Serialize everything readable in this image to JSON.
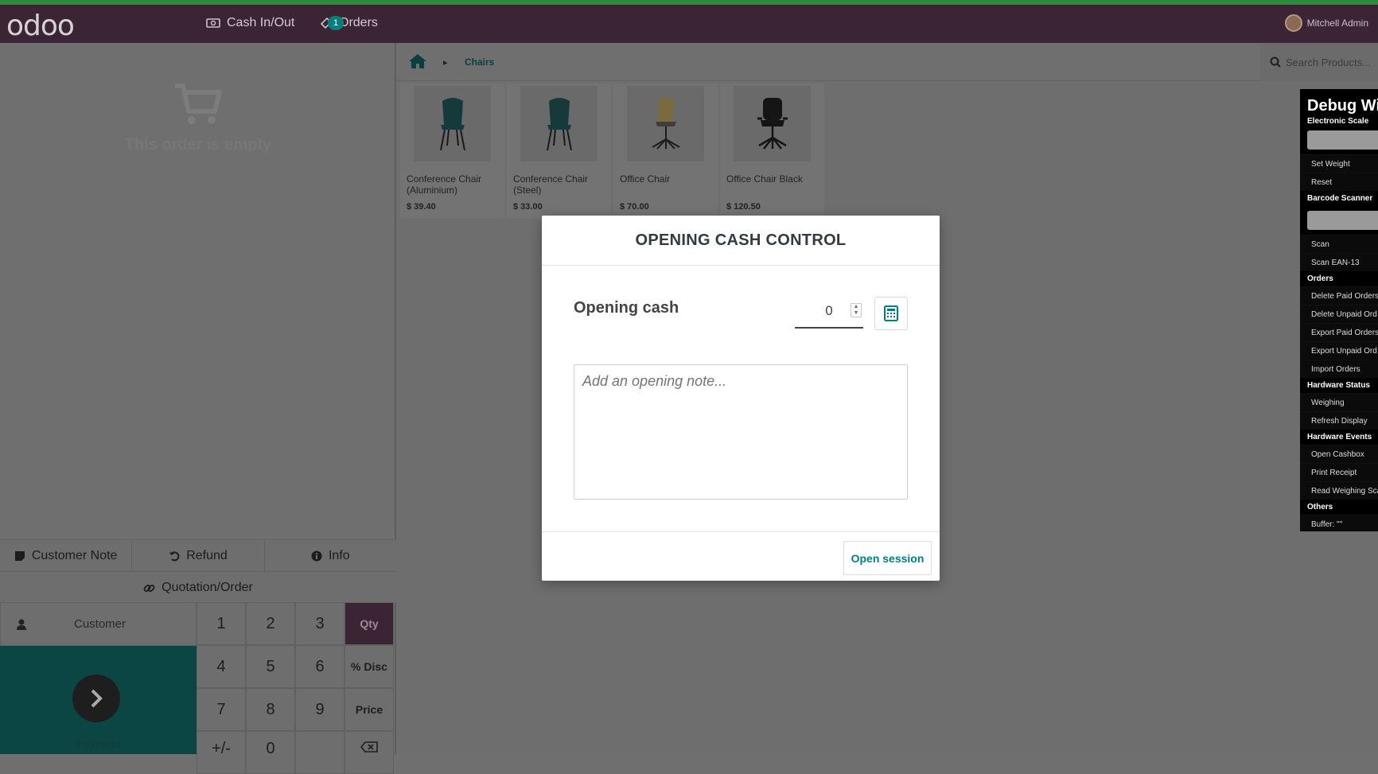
{
  "navbar": {
    "logo": "odoo",
    "cash_in_out": "Cash In/Out",
    "orders": "Orders",
    "orders_count": "1",
    "user_name": "Mitchell Admin"
  },
  "order": {
    "empty_text": "This order is empty"
  },
  "controls": {
    "customer_note": "Customer Note",
    "refund": "Refund",
    "info": "Info",
    "quotation_order": "Quotation/Order"
  },
  "numpad": {
    "customer": "Customer",
    "payment": "Payment",
    "keys": [
      "1",
      "2",
      "3",
      "4",
      "5",
      "6",
      "7",
      "8",
      "9",
      "+/-",
      "0"
    ],
    "modes": {
      "qty": "Qty",
      "disc": "% Disc",
      "price": "Price"
    }
  },
  "breadcrumb": {
    "category": "Chairs"
  },
  "search": {
    "placeholder": "Search Products..."
  },
  "products": [
    {
      "name": "Conference Chair (Aluminium)",
      "price": "$ 39.40"
    },
    {
      "name": "Conference Chair (Steel)",
      "price": "$ 33.00"
    },
    {
      "name": "Office Chair",
      "price": "$ 70.00"
    },
    {
      "name": "Office Chair Black",
      "price": "$ 120.50"
    }
  ],
  "debug": {
    "title": "Debug Wi",
    "electronic_scale": "Electronic Scale",
    "set_weight": "Set Weight",
    "reset": "Reset",
    "barcode_scanner": "Barcode Scanner",
    "scan": "Scan",
    "scan_ean": "Scan EAN-13",
    "orders": "Orders",
    "delete_paid": "Delete Paid Orders",
    "delete_unpaid": "Delete Unpaid Ord",
    "export_paid": "Export Paid Orders",
    "export_unpaid": "Export Unpaid Ord",
    "import_orders": "Import Orders",
    "hardware_status": "Hardware Status",
    "weighing": "Weighing",
    "refresh_display": "Refresh Display",
    "hardware_events": "Hardware Events",
    "open_cashbox": "Open Cashbox",
    "print_receipt": "Print Receipt",
    "read_weighing": "Read Weighing Sca",
    "others": "Others",
    "buffer": "Buffer: \"\""
  },
  "modal": {
    "title": "OPENING CASH CONTROL",
    "opening_cash_label": "Opening cash",
    "opening_cash_value": "0",
    "note_placeholder": "Add an opening note...",
    "open_session": "Open session"
  }
}
